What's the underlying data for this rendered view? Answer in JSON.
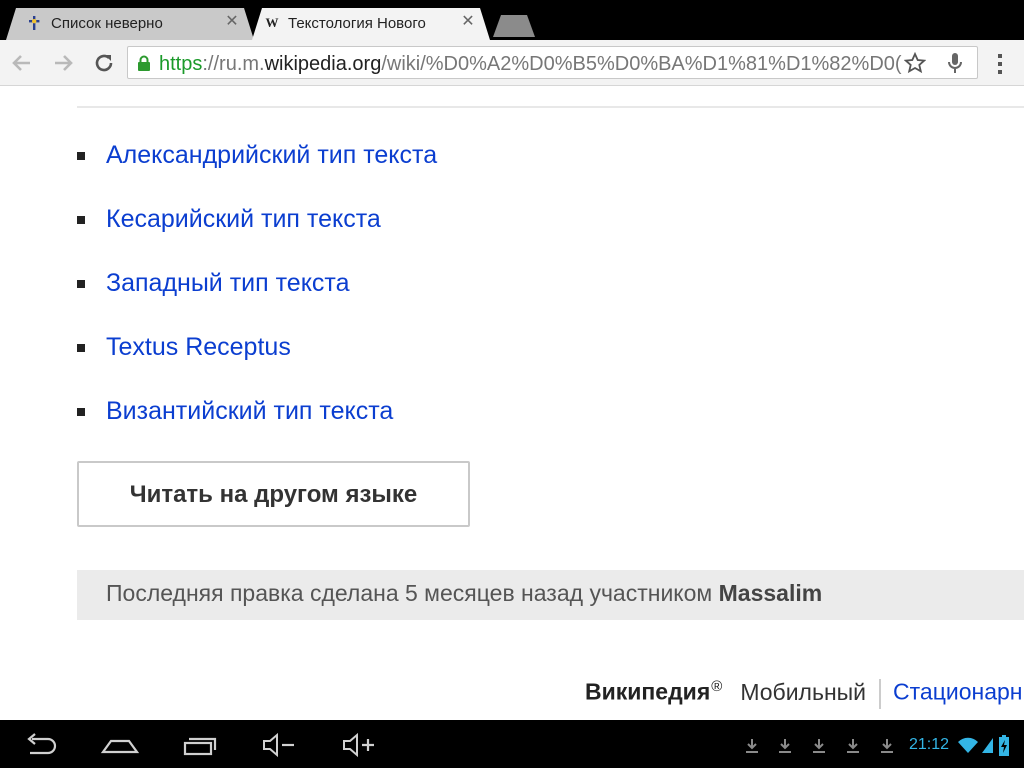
{
  "tabs": [
    {
      "title": "Список неверно",
      "favicon": "cross-favicon-icon",
      "active": false
    },
    {
      "title": "Текстология Нового",
      "favicon": "wikipedia-w-icon",
      "favicon_glyph": "W",
      "active": true
    }
  ],
  "omnibox": {
    "scheme": "https",
    "separator": "://",
    "subdomain": "ru.m.",
    "domain": "wikipedia.org",
    "path": "/wiki/%D0%A2%D0%B5%D0%BA%D1%81%D1%82%D0(",
    "secure": true
  },
  "toolbar": {
    "back_icon": "back-arrow-icon",
    "forward_icon": "forward-arrow-icon",
    "reload_icon": "reload-icon",
    "star_icon": "star-icon",
    "mic_icon": "microphone-icon",
    "menu_icon": "overflow-menu-icon"
  },
  "languages": [
    {
      "label": "Александрийский тип текста"
    },
    {
      "label": "Кесарийский тип текста"
    },
    {
      "label": "Западный тип текста"
    },
    {
      "label": "Textus Receptus"
    },
    {
      "label": "Византийский тип текста"
    }
  ],
  "read_other_language_button": "Читать на другом языке",
  "last_edit": {
    "text": "Последняя правка сделана 5 месяцев назад участником",
    "user": "Massalim"
  },
  "footer": {
    "brand": "Википедия",
    "registered": "®",
    "mobile": "Мобильный",
    "desktop": "Стационарный"
  },
  "system_bar": {
    "time": "21:12",
    "nav_icons": [
      "back-icon",
      "home-icon",
      "recent-apps-icon",
      "volume-down-icon",
      "volume-up-icon"
    ],
    "notification_icons": [
      "download-icon",
      "download-icon",
      "download-icon",
      "download-icon",
      "download-icon"
    ],
    "status_icons": [
      "wifi-icon",
      "signal-icon",
      "battery-charging-icon"
    ]
  },
  "colors": {
    "link": "#0b3ed0",
    "secure_green": "#1b9a2a",
    "clock": "#33b5e5",
    "tab_active": "#f3f3f3",
    "tab_inactive": "#c9c9c9"
  }
}
